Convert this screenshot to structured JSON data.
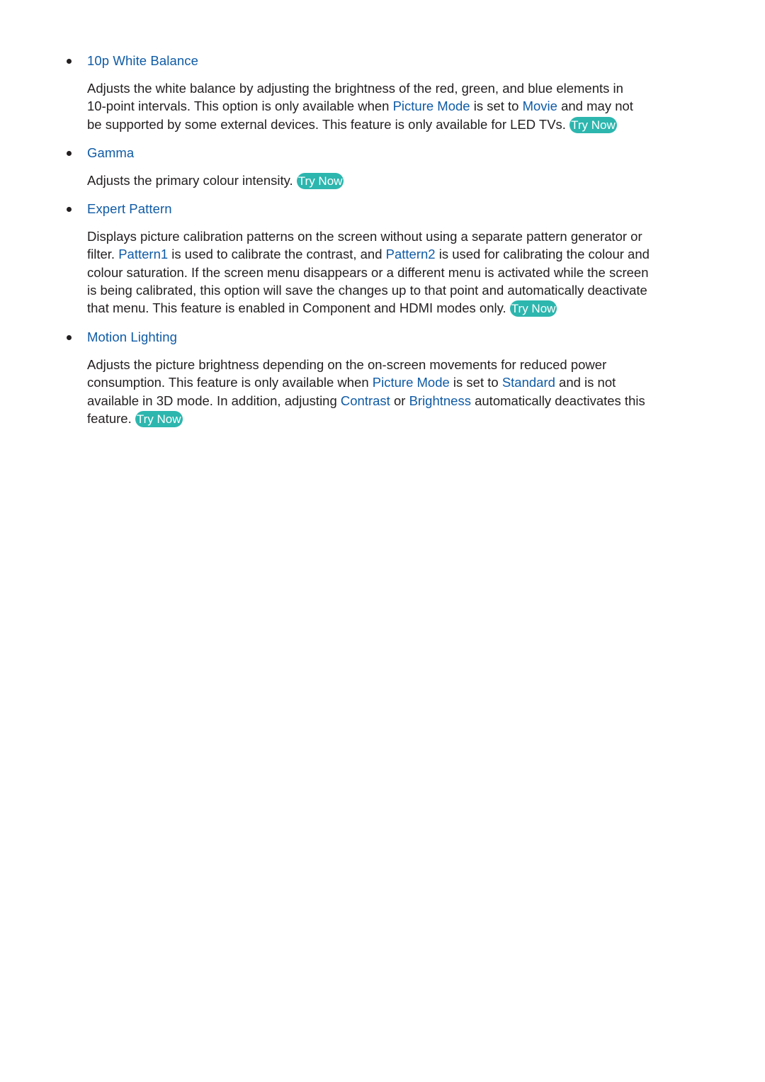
{
  "sections": [
    {
      "title": "10p White Balance",
      "lines": [
        [
          "Adjusts the white balance by adjusting the brightness of the red, green, and blue elements in"
        ],
        [
          "10-point intervals. This option is only available when ",
          {
            "link": "Picture Mode"
          },
          " is set to ",
          {
            "link": "Movie"
          },
          " and may not"
        ],
        [
          "be supported by some external devices. This feature is only available for LED TVs. ",
          {
            "button": "Try Now"
          }
        ]
      ]
    },
    {
      "title": "Gamma",
      "lines": [
        [
          "Adjusts the primary colour intensity. ",
          {
            "button": "Try Now"
          }
        ]
      ]
    },
    {
      "title": "Expert Pattern",
      "lines": [
        [
          "Displays picture calibration patterns on the screen without using a separate pattern generator or"
        ],
        [
          "filter. ",
          {
            "link": "Pattern1"
          },
          " is used to calibrate the contrast, and ",
          {
            "link": "Pattern2"
          },
          " is used for calibrating the colour and"
        ],
        [
          "colour saturation. If the screen menu disappears or a different menu is activated while the screen"
        ],
        [
          "is being calibrated, this option will save the changes up to that point and automatically deactivate"
        ],
        [
          "that menu. This feature is enabled in Component and HDMI modes only. ",
          {
            "button": "Try Now"
          }
        ]
      ]
    },
    {
      "title": "Motion Lighting",
      "lines": [
        [
          "Adjusts the picture brightness depending on the on-screen movements for reduced power"
        ],
        [
          "consumption. This feature is only available when ",
          {
            "link": "Picture Mode"
          },
          " is set to ",
          {
            "link": "Standard"
          },
          " and is not"
        ],
        [
          "available in 3D mode. In addition, adjusting ",
          {
            "link": "Contrast"
          },
          " or ",
          {
            "link": "Brightness"
          },
          " automatically deactivates this"
        ],
        [
          "feature. ",
          {
            "button": "Try Now"
          }
        ]
      ]
    }
  ],
  "colors": {
    "heading": "#0f5ba6",
    "link": "#0f5ba6",
    "body_text": "#231f20",
    "try_now_bg": "#2cb6ae",
    "try_now_text": "#ffffff"
  }
}
